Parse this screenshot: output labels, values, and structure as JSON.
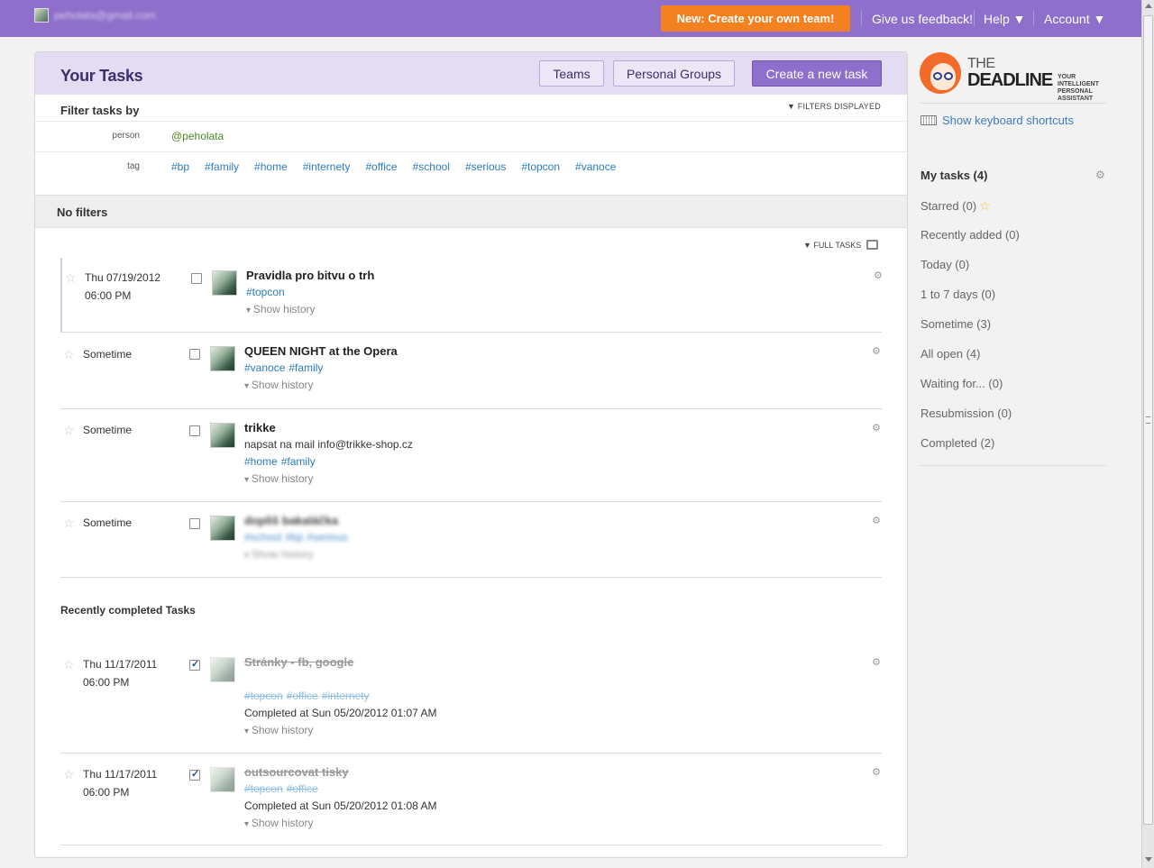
{
  "topbar": {
    "user_email": "peholata@gmail.com",
    "create_team_label": "New: Create your own team!",
    "feedback_label": "Give us feedback!",
    "help_label": "Help ▼",
    "account_label": "Account ▼"
  },
  "panel": {
    "title": "Your Tasks",
    "teams_label": "Teams",
    "groups_label": "Personal Groups",
    "create_task_label": "Create a new task",
    "filter_label": "Filter tasks by",
    "filters_displayed": "▼ FILTERS DISPLAYED",
    "person_label": "person",
    "person_value": "@peholata",
    "tag_label": "tag",
    "tags": [
      "#bp",
      "#family",
      "#home",
      "#internety",
      "#office",
      "#school",
      "#serious",
      "#topcon",
      "#vanoce"
    ],
    "no_filters": "No filters",
    "full_tasks": "▼ FULL TASKS",
    "recent_label": "Recently completed Tasks"
  },
  "tasks": [
    {
      "date": "Thu 07/19/2012",
      "time": "06:00 PM",
      "name": "Pravidla pro bitvu o trh",
      "note": "",
      "tags": [
        "#topcon"
      ],
      "history": "Show history"
    },
    {
      "date": "Sometime",
      "time": "",
      "name": "QUEEN NIGHT at the Opera",
      "note": "",
      "tags": [
        "#vanoce",
        "#family"
      ],
      "history": "Show history"
    },
    {
      "date": "Sometime",
      "time": "",
      "name": "trikke",
      "note": "napsat na mail info@trikke-shop.cz",
      "tags": [
        "#home",
        "#family"
      ],
      "history": "Show history"
    },
    {
      "date": "Sometime",
      "time": "",
      "name": "dopliš bakaláčka",
      "note": "",
      "tags": [
        "#school",
        "#bp",
        "#serious"
      ],
      "history": "Show history"
    }
  ],
  "completed": [
    {
      "date": "Thu 11/17/2011",
      "time": "06:00 PM",
      "name": "Stránky - fb, google",
      "tags": [
        "#topcon",
        "#office",
        "#internety"
      ],
      "completed_at": "Completed at Sun 05/20/2012 01:07 AM",
      "history": "Show history"
    },
    {
      "date": "Thu 11/17/2011",
      "time": "06:00 PM",
      "name": "outsourcovat tisky",
      "tags": [
        "#topcon",
        "#office"
      ],
      "completed_at": "Completed at Sun 05/20/2012 01:08 AM",
      "history": "Show history"
    }
  ],
  "sidebar": {
    "logo_the": "THE",
    "logo_deadline": "DEADLINE",
    "logo_sub": "YOUR INTELLIGENT PERSONAL ASSISTANT",
    "keyboard_shortcuts": "Show keyboard shortcuts",
    "items": [
      "My tasks (4)",
      "Starred (0)",
      "Recently added (0)",
      "Today (0)",
      "1 to 7 days (0)",
      "Sometime (3)",
      "All open (4)",
      "Waiting for... (0)",
      "Resubmission (0)",
      "Completed (2)"
    ]
  },
  "colors": {
    "topbar": "#8e6fcb",
    "accent_orange": "#f4811f",
    "tag_blue": "#2a7cbf",
    "person_green": "#4c8a23"
  }
}
